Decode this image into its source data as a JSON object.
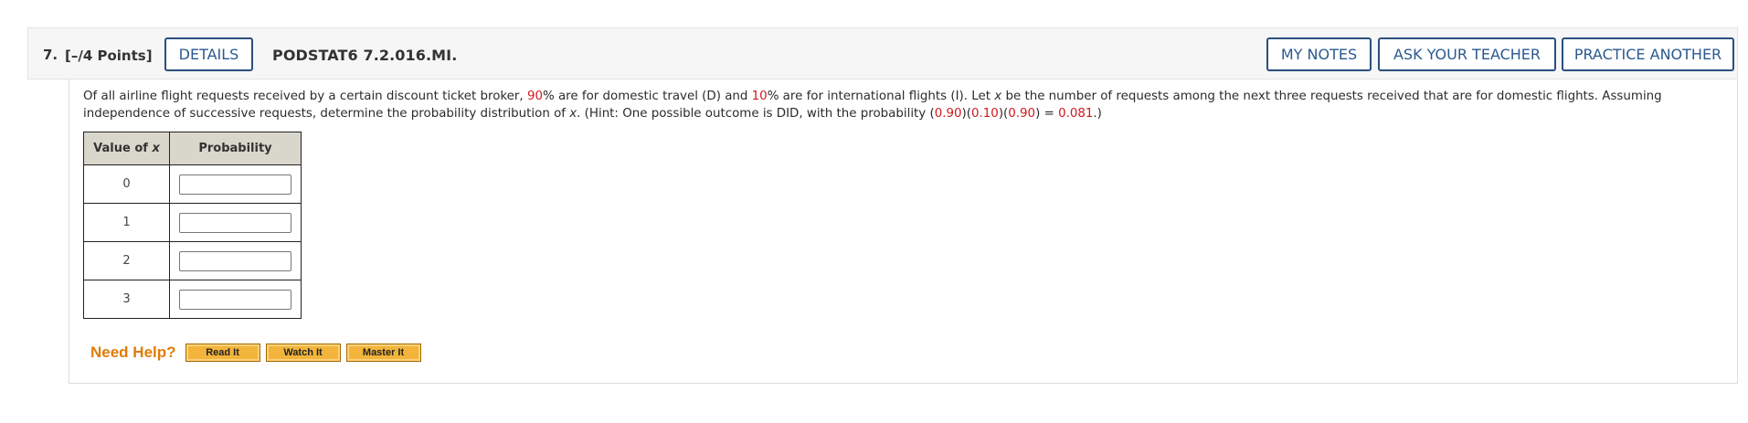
{
  "header": {
    "number": "7.",
    "points": "[–/4 Points]",
    "details_label": "DETAILS",
    "reference": "PODSTAT6 7.2.016.MI.",
    "my_notes_label": "MY NOTES",
    "ask_teacher_label": "ASK YOUR TEACHER",
    "practice_label": "PRACTICE ANOTHER"
  },
  "question": {
    "t1": "Of all airline flight requests received by a certain discount ticket broker, ",
    "pct_domestic": "90",
    "t2": "% are for domestic travel (D) and ",
    "pct_international": "10",
    "t3": "% are for international flights (I). Let ",
    "var_x": "x",
    "t4": " be the number of requests among the next three requests received that are for domestic flights. Assuming independence of successive requests, determine the probability distribution of ",
    "t5": ". (Hint: One possible outcome is DID, with the probability (",
    "p1": "0.90",
    "sep": ")(",
    "p2": "0.10",
    "p3": "0.90",
    "t6": ") = ",
    "result": "0.081",
    "t7": ".)"
  },
  "table": {
    "header_value": "Value of ",
    "header_var": "x",
    "header_probability": "Probability",
    "rows": [
      {
        "x": "0",
        "answer": ""
      },
      {
        "x": "1",
        "answer": ""
      },
      {
        "x": "2",
        "answer": ""
      },
      {
        "x": "3",
        "answer": ""
      }
    ]
  },
  "help": {
    "label": "Need Help?",
    "read_label": "Read It",
    "watch_label": "Watch It",
    "master_label": "Master It"
  },
  "colors": {
    "accent_blue": "#2a5a8f",
    "highlight_red": "#d0191e",
    "help_orange": "#e07c08"
  }
}
